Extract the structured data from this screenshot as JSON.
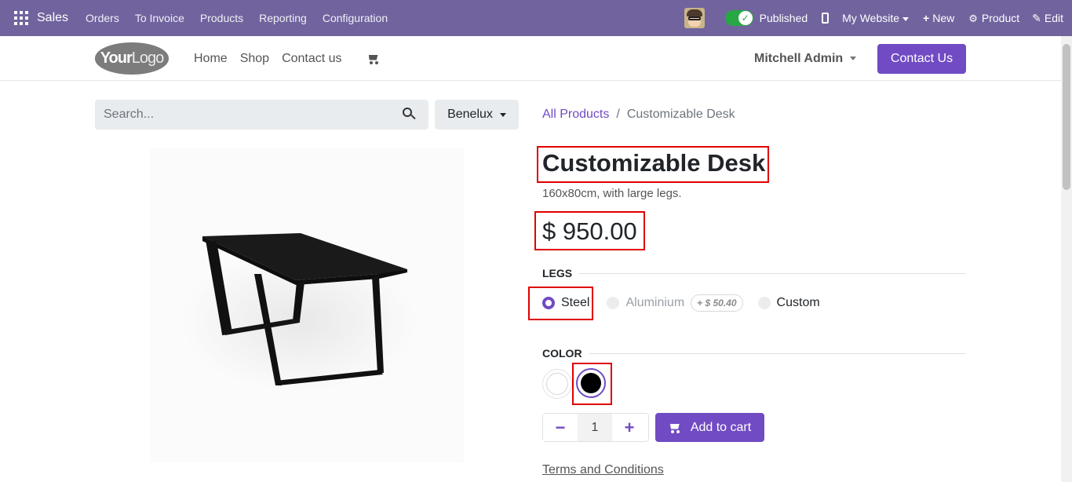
{
  "topbar": {
    "app_name": "Sales",
    "menu": [
      "Orders",
      "To Invoice",
      "Products",
      "Reporting",
      "Configuration"
    ],
    "published_label": "Published",
    "website_label": "My Website",
    "new_label": "New",
    "product_label": "Product",
    "edit_label": "Edit",
    "bg_color": "#71639e"
  },
  "header": {
    "logo_text_bold": "Your",
    "logo_text_light": "Logo",
    "nav": [
      "Home",
      "Shop",
      "Contact us"
    ],
    "user_name": "Mitchell Admin",
    "contact_button": "Contact Us",
    "accent_color": "#714bc3"
  },
  "search": {
    "placeholder": "Search...",
    "pricelist": "Benelux"
  },
  "breadcrumb": {
    "parent": "All Products",
    "separator": "/",
    "current": "Customizable Desk"
  },
  "product": {
    "name": "Customizable Desk",
    "description": "160x80cm, with large legs.",
    "price": "$ 950.00",
    "attributes": {
      "legs": {
        "title": "LEGS",
        "options": [
          {
            "label": "Steel",
            "selected": true
          },
          {
            "label": "Aluminium",
            "selected": false,
            "extra": "+ $ 50.40"
          },
          {
            "label": "Custom",
            "selected": false
          }
        ]
      },
      "color": {
        "title": "COLOR",
        "options": [
          {
            "name": "White",
            "hex": "#ffffff",
            "selected": false
          },
          {
            "name": "Black",
            "hex": "#000000",
            "selected": true
          }
        ]
      }
    },
    "quantity": "1",
    "add_to_cart": "Add to cart",
    "terms": "Terms and Conditions"
  }
}
